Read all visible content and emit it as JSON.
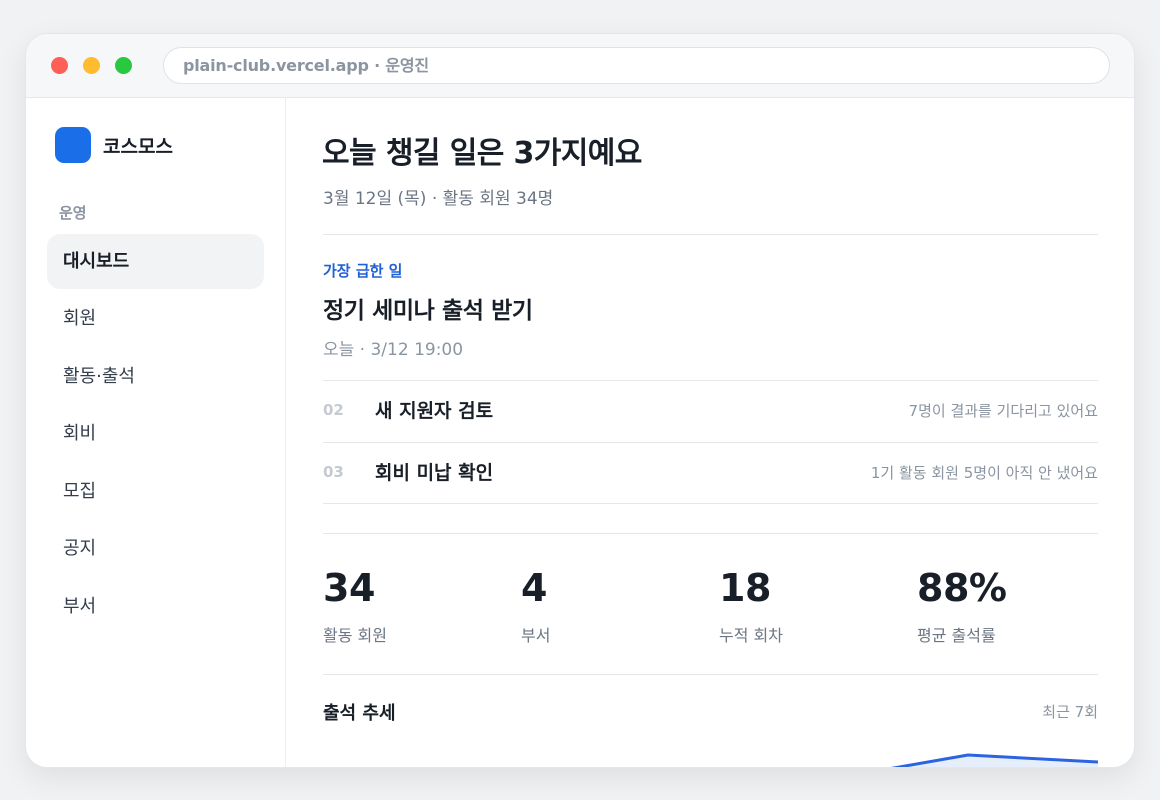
{
  "browser": {
    "url": "plain-club.vercel.app · 운영진"
  },
  "sidebar": {
    "brand": "코스모스",
    "section": "운영",
    "items": [
      {
        "label": "대시보드",
        "active": true
      },
      {
        "label": "회원"
      },
      {
        "label": "활동·출석"
      },
      {
        "label": "회비"
      },
      {
        "label": "모집"
      },
      {
        "label": "공지"
      },
      {
        "label": "부서"
      }
    ]
  },
  "main": {
    "title": "오늘 챙길 일은 3가지예요",
    "subtitle": "3월 12일 (목) · 활동 회원 34명",
    "urgent": {
      "label": "가장 급한 일",
      "title": "정기 세미나 출석 받기",
      "meta": "오늘 · 3/12 19:00"
    },
    "tasks": [
      {
        "num": "02",
        "title": "새 지원자 검토",
        "desc": "7명이 결과를 기다리고 있어요"
      },
      {
        "num": "03",
        "title": "회비 미납 확인",
        "desc": "1기 활동 회원 5명이 아직 안 냈어요"
      }
    ],
    "stats": [
      {
        "value": "34",
        "label": "활동 회원"
      },
      {
        "value": "4",
        "label": "부서"
      },
      {
        "value": "18",
        "label": "누적 회차"
      },
      {
        "value": "88%",
        "label": "평균 출석률"
      }
    ],
    "trend": {
      "title": "출석 추세",
      "range": "최근 7회",
      "accent": "#2b63e0"
    }
  }
}
